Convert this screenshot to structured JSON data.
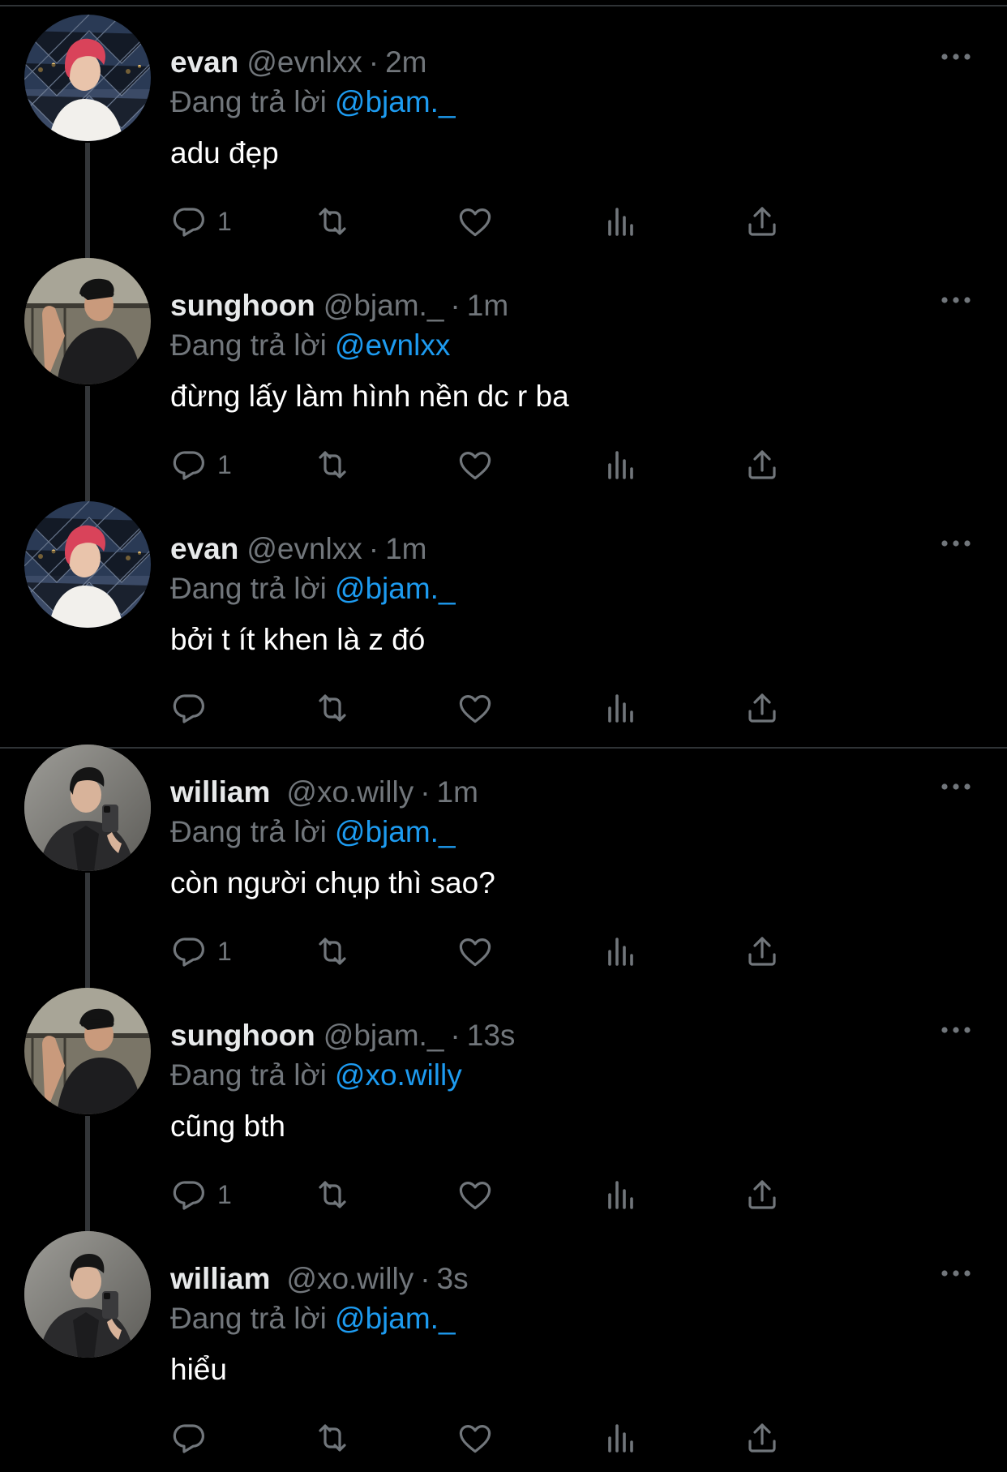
{
  "theme": {
    "background": "#000000",
    "text": "#e7e9ea",
    "muted": "#71767b",
    "link": "#1d9bf0",
    "divider": "#2f3336"
  },
  "labels": {
    "reply_prefix": "Đang trả lời",
    "separator": "·"
  },
  "threads": [
    {
      "tweets": [
        {
          "display_name": "evan",
          "handle": "@evnlxx",
          "time": "2m",
          "reply_to": "@bjam._",
          "text": "adu đẹp",
          "reply_count": "1",
          "avatar": "evan-avatar"
        },
        {
          "display_name": "sunghoon",
          "handle": "@bjam._",
          "time": "1m",
          "reply_to": "@evnlxx",
          "text": "đừng lấy làm hình nền dc r ba",
          "reply_count": "1",
          "avatar": "sunghoon-avatar"
        },
        {
          "display_name": "evan",
          "handle": "@evnlxx",
          "time": "1m",
          "reply_to": "@bjam._",
          "text": "bởi t ít khen là z đó",
          "reply_count": "",
          "avatar": "evan-avatar"
        }
      ]
    },
    {
      "tweets": [
        {
          "display_name": "william",
          "handle": "@xo.willy",
          "time": "1m",
          "reply_to": "@bjam._",
          "text": "còn người chụp thì sao?",
          "reply_count": "1",
          "avatar": "william-avatar"
        },
        {
          "display_name": "sunghoon",
          "handle": "@bjam._",
          "time": "13s",
          "reply_to": "@xo.willy",
          "text": "cũng bth",
          "reply_count": "1",
          "avatar": "sunghoon-avatar"
        },
        {
          "display_name": "william",
          "handle": "@xo.willy",
          "time": "3s",
          "reply_to": "@bjam._",
          "text": "hiểu",
          "reply_count": "",
          "avatar": "william-avatar"
        }
      ]
    }
  ]
}
